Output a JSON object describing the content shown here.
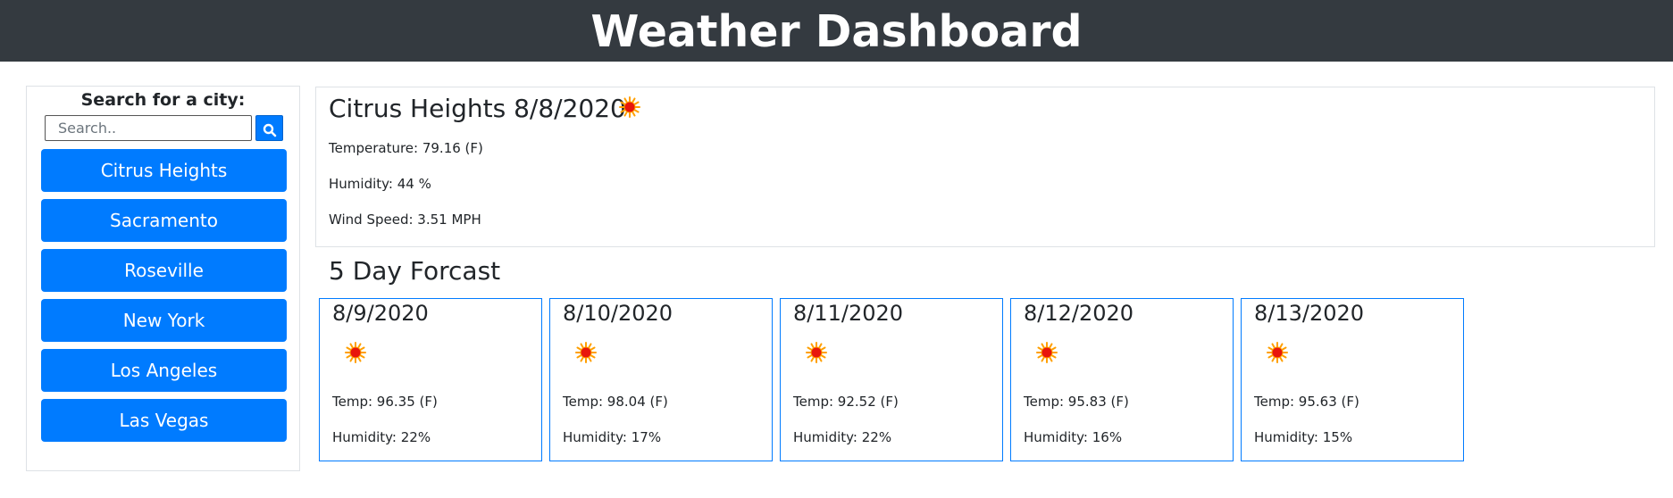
{
  "header": {
    "title": "Weather Dashboard"
  },
  "sidebar": {
    "search_label": "Search for a city:",
    "search_placeholder": "Search..",
    "search_button_icon": "search-icon",
    "cities": [
      "Citrus Heights",
      "Sacramento",
      "Roseville",
      "New York",
      "Los Angeles",
      "Las Vegas"
    ]
  },
  "current": {
    "title": "Citrus Heights 8/8/2020",
    "icon": "sun-icon",
    "temperature": "Temperature: 79.16 (F)",
    "humidity": "Humidity: 44 %",
    "wind": "Wind Speed: 3.51 MPH"
  },
  "forecast": {
    "heading": "5 Day Forcast",
    "days": [
      {
        "date": "8/9/2020",
        "icon": "sun-icon",
        "temp": "Temp: 96.35 (F)",
        "humidity": "Humidity: 22%"
      },
      {
        "date": "8/10/2020",
        "icon": "sun-icon",
        "temp": "Temp: 98.04 (F)",
        "humidity": "Humidity: 17%"
      },
      {
        "date": "8/11/2020",
        "icon": "sun-icon",
        "temp": "Temp: 92.52 (F)",
        "humidity": "Humidity: 22%"
      },
      {
        "date": "8/12/2020",
        "icon": "sun-icon",
        "temp": "Temp: 95.83 (F)",
        "humidity": "Humidity: 16%"
      },
      {
        "date": "8/13/2020",
        "icon": "sun-icon",
        "temp": "Temp: 95.63 (F)",
        "humidity": "Humidity: 15%"
      }
    ]
  },
  "colors": {
    "header_bg": "#343a40",
    "primary": "#007bff",
    "border": "#dee2e6",
    "sun_core": "#e8160c",
    "sun_rays": "#ff9f00"
  }
}
